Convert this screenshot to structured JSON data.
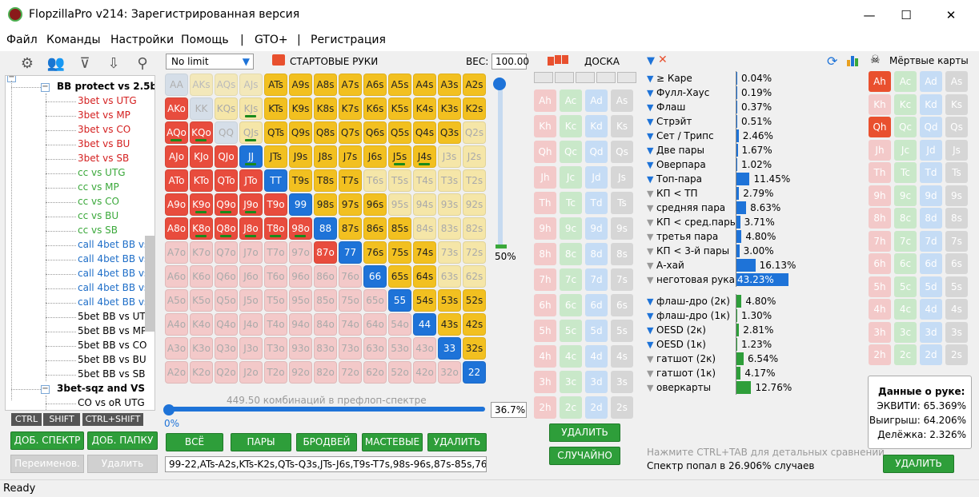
{
  "window": {
    "title": "FlopzillaPro v214: Зарегистрированная версия",
    "minimize": "—",
    "maximize": "☐",
    "close": "✕"
  },
  "menu": [
    "Файл",
    "Команды",
    "Настройки",
    "Помощь",
    "|",
    "GTO+",
    "|",
    "Регистрация"
  ],
  "left_panel": {
    "toolbar_icons": [
      "gear-icon",
      "users-icon",
      "filter-icon",
      "import-icon",
      "search-icon"
    ],
    "tree": [
      {
        "label": "BB protect vs 2.5bb",
        "color": "#000",
        "bold": true,
        "group": true
      },
      {
        "label": "3bet vs UTG",
        "color": "#d42020"
      },
      {
        "label": "3bet vs MP",
        "color": "#d42020"
      },
      {
        "label": "3bet vs CO",
        "color": "#d42020"
      },
      {
        "label": "3bet vs BU",
        "color": "#d42020"
      },
      {
        "label": "3bet vs SB",
        "color": "#d42020"
      },
      {
        "label": "cc vs UTG",
        "color": "#3aa83a"
      },
      {
        "label": "cc vs MP",
        "color": "#3aa83a"
      },
      {
        "label": "cc vs CO",
        "color": "#3aa83a"
      },
      {
        "label": "cc vs BU",
        "color": "#3aa83a"
      },
      {
        "label": "cc vs SB",
        "color": "#3aa83a"
      },
      {
        "label": "call 4bet BB vs U",
        "color": "#1e6ec8"
      },
      {
        "label": "call 4bet BB vs M",
        "color": "#1e6ec8"
      },
      {
        "label": "call 4bet BB vs C",
        "color": "#1e6ec8"
      },
      {
        "label": "call 4bet BB vs B",
        "color": "#1e6ec8"
      },
      {
        "label": "call 4bet BB vs S",
        "color": "#1e6ec8"
      },
      {
        "label": "5bet BB vs UTG",
        "color": "#000"
      },
      {
        "label": "5bet BB vs MP",
        "color": "#000"
      },
      {
        "label": "5bet BB vs CO",
        "color": "#000"
      },
      {
        "label": "5bet BB vs BU",
        "color": "#000"
      },
      {
        "label": "5bet BB vs SB",
        "color": "#000"
      },
      {
        "label": "3bet-sqz and VS",
        "color": "#000",
        "bold": true,
        "group": true
      },
      {
        "label": "CO vs oR UTG",
        "color": "#000"
      }
    ],
    "key_tabs": [
      "CTRL",
      "SHIFT",
      "CTRL+SHIFT"
    ],
    "buttons": {
      "add_range": "ДОБ. СПЕКТР",
      "add_folder": "ДОБ. ПАПКУ",
      "rename": "Переименов.",
      "delete": "Удалить"
    }
  },
  "range": {
    "limit_select": "No limit",
    "title": "СТАРТОВЫЕ РУКИ",
    "weight_label": "ВЕС:",
    "weight_value": "100.00",
    "vslider_value": "50%",
    "combos_text": "449.50 комбинаций в префлоп-спектре",
    "hslider_left": "0%",
    "hslider_value": "36.7%",
    "buttons": [
      "ВСЁ",
      "ПАРЫ",
      "БРОДВЕЙ",
      "МАСТЕВЫЕ",
      "УДАЛИТЬ"
    ],
    "range_text": "99-22,ATs-A2s,KTs-K2s,QTs-Q3s,JTs-J6s,T9s-T7s,98s-96s,87s-85s,76",
    "ranks": [
      "A",
      "K",
      "Q",
      "J",
      "T",
      "9",
      "8",
      "7",
      "6",
      "5",
      "4",
      "3",
      "2"
    ],
    "selected": [
      "99",
      "88",
      "77",
      "66",
      "55",
      "44",
      "33",
      "22",
      "ATs",
      "A9s",
      "A8s",
      "A7s",
      "A6s",
      "A5s",
      "A4s",
      "A3s",
      "A2s",
      "KTs",
      "K9s",
      "K8s",
      "K7s",
      "K6s",
      "K5s",
      "K4s",
      "K3s",
      "K2s",
      "QTs",
      "Q9s",
      "Q8s",
      "Q7s",
      "Q6s",
      "Q5s",
      "Q4s",
      "Q3s",
      "JTs",
      "J9s",
      "J8s",
      "J7s",
      "J6s",
      "J5s",
      "J4s",
      "T9s",
      "T8s",
      "T7s",
      "98s",
      "97s",
      "96s",
      "87s",
      "86s",
      "85s",
      "76s",
      "75s",
      "74s",
      "65s",
      "64s",
      "54s",
      "53s",
      "52s",
      "43s",
      "42s",
      "32s",
      "JJ",
      "TT",
      "AKo",
      "AQo",
      "AJo",
      "ATo",
      "A9o",
      "A8o",
      "KQo",
      "KJo",
      "KTo",
      "K9o",
      "K8o",
      "QJo",
      "QTo",
      "Q9o",
      "Q8o",
      "JTo",
      "J9o",
      "J8o",
      "T9o",
      "T8o",
      "98o",
      "87o"
    ],
    "partial": [
      "AKs",
      "AQs",
      "AJs",
      "AA",
      "KK",
      "QQ"
    ],
    "marked": [
      "AQo",
      "KQo",
      "QJs",
      "JJ",
      "J5s",
      "J4s",
      "KJs",
      "K9o",
      "Q9o",
      "J9o",
      "K8o",
      "Q8o",
      "J8o",
      "T8o",
      "98o"
    ]
  },
  "board": {
    "title": "ДОСКА",
    "suits": [
      "h",
      "c",
      "d",
      "s"
    ],
    "selected": [],
    "buttons": {
      "delete": "УДАЛИТЬ",
      "random": "СЛУЧАЙНО"
    }
  },
  "stats": {
    "rows": [
      {
        "label": "≥ Каре",
        "value": "0.04%",
        "pct": 0.04,
        "active": true
      },
      {
        "label": "Фулл-Хаус",
        "value": "0.19%",
        "pct": 0.19,
        "active": true
      },
      {
        "label": "Флаш",
        "value": "0.37%",
        "pct": 0.37,
        "active": true
      },
      {
        "label": "Стрэйт",
        "value": "0.51%",
        "pct": 0.51,
        "active": true
      },
      {
        "label": "Сет / Трипс",
        "value": "2.46%",
        "pct": 2.46,
        "active": true
      },
      {
        "label": "Две пары",
        "value": "1.67%",
        "pct": 1.67,
        "active": true
      },
      {
        "label": "Оверпара",
        "value": "1.02%",
        "pct": 1.02,
        "active": true
      },
      {
        "label": "Топ-пара",
        "value": "11.45%",
        "pct": 11.45,
        "active": true
      },
      {
        "label": "КП < ТП",
        "value": "2.79%",
        "pct": 2.79,
        "active": false
      },
      {
        "label": "средняя пара",
        "value": "8.63%",
        "pct": 8.63,
        "active": false
      },
      {
        "label": "КП < сред.пары",
        "value": "3.71%",
        "pct": 3.71,
        "active": false
      },
      {
        "label": "третья пара",
        "value": "4.80%",
        "pct": 4.8,
        "active": false
      },
      {
        "label": "КП < 3-й пары",
        "value": "3.00%",
        "pct": 3.0,
        "active": false
      },
      {
        "label": "А-хай",
        "value": "16.13%",
        "pct": 16.13,
        "active": false
      },
      {
        "label": "неготовая рука",
        "value": "43.23%",
        "pct": 43.23,
        "active": false
      }
    ],
    "draws": [
      {
        "label": "флаш-дро (2к)",
        "value": "4.80%",
        "pct": 4.8,
        "active": true
      },
      {
        "label": "флаш-дро (1к)",
        "value": "1.30%",
        "pct": 1.3,
        "active": true
      },
      {
        "label": "OESD (2к)",
        "value": "2.81%",
        "pct": 2.81,
        "active": true
      },
      {
        "label": "OESD (1к)",
        "value": "1.23%",
        "pct": 1.23,
        "active": true
      },
      {
        "label": "гатшот (2к)",
        "value": "6.54%",
        "pct": 6.54,
        "active": false
      },
      {
        "label": "гатшот (1к)",
        "value": "4.17%",
        "pct": 4.17,
        "active": false
      },
      {
        "label": "оверкарты",
        "value": "12.76%",
        "pct": 12.76,
        "active": false
      }
    ],
    "hint": "Нажмите CTRL+TAB для детальных сравнений",
    "hit": "Спектр попал в 26.906% случаев"
  },
  "dead": {
    "title": "Мёртвые карты",
    "selected": [
      "Ah",
      "Qh"
    ],
    "info_title": "Данные о руке:",
    "equity": "ЭКВИТИ: 65.369%",
    "win": "Выигрыш: 64.206%",
    "tie": "Делёжка: 2.326%",
    "delete": "УДАЛИТЬ"
  },
  "status": "Ready"
}
